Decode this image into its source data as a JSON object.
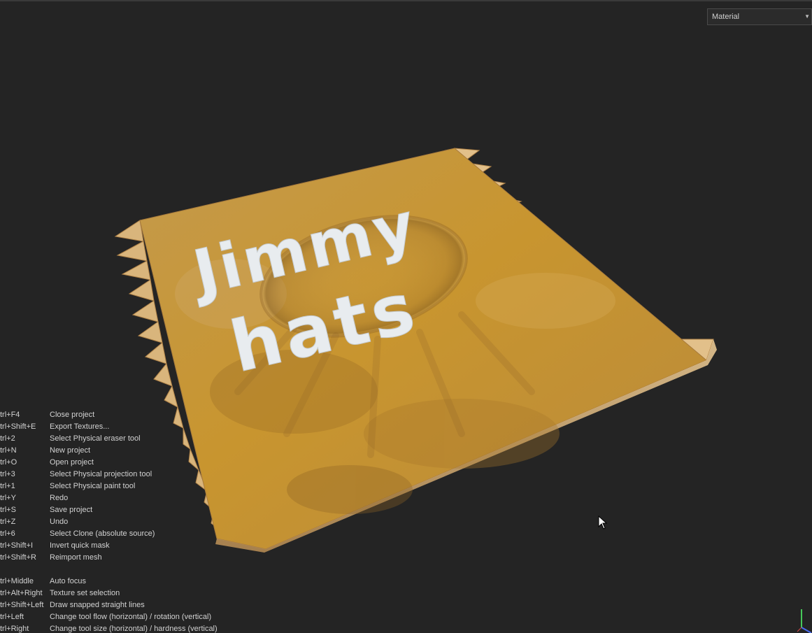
{
  "viewport": {
    "channel_dropdown": {
      "value": "Material"
    },
    "label": {
      "line1": "Jimmy",
      "line2": "hats"
    }
  },
  "shortcuts": {
    "group1": [
      {
        "key": "trl+F4",
        "action": "Close project"
      },
      {
        "key": "trl+Shift+E",
        "action": "Export Textures..."
      },
      {
        "key": "trl+2",
        "action": "Select Physical eraser tool"
      },
      {
        "key": "trl+N",
        "action": "New project"
      },
      {
        "key": "trl+O",
        "action": "Open project"
      },
      {
        "key": "trl+3",
        "action": "Select Physical projection tool"
      },
      {
        "key": "trl+1",
        "action": "Select Physical paint tool"
      },
      {
        "key": "trl+Y",
        "action": "Redo"
      },
      {
        "key": "trl+S",
        "action": "Save project"
      },
      {
        "key": "trl+Z",
        "action": "Undo"
      },
      {
        "key": "trl+6",
        "action": "Select Clone (absolute source)"
      },
      {
        "key": "trl+Shift+I",
        "action": "Invert quick mask"
      },
      {
        "key": "trl+Shift+R",
        "action": "Reimport mesh"
      }
    ],
    "group2": [
      {
        "key": "trl+Middle",
        "action": "Auto focus"
      },
      {
        "key": "trl+Alt+Right",
        "action": "Texture set selection"
      },
      {
        "key": "trl+Shift+Left",
        "action": "Draw snapped straight lines"
      },
      {
        "key": "trl+Left",
        "action": "Change tool flow (horizontal) / rotation (vertical)"
      },
      {
        "key": "trl+Right",
        "action": "Change tool size (horizontal) / hardness (vertical)"
      }
    ]
  },
  "colors": {
    "background": "#242424",
    "material_base": "#c99a3a",
    "material_dark": "#a7742a",
    "label_text": "#e8ecef"
  },
  "icons": {
    "cursor": "arrow-cursor-icon",
    "axis": "axis-gizmo-icon",
    "dropdown": "chevron-down-icon"
  }
}
